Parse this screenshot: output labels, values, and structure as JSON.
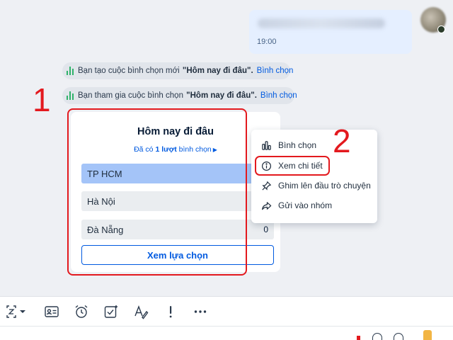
{
  "message": {
    "time": "19:00"
  },
  "notices": [
    {
      "prefix": "Bạn tạo cuộc bình chọn mới",
      "quote": "\"Hôm nay đi đâu\".",
      "link": "Bình chọn"
    },
    {
      "prefix": "Bạn tham gia cuộc bình chọn",
      "quote": "\"Hôm nay đi đâu\".",
      "link": "Bình chọn"
    }
  ],
  "annotations": {
    "step1": "1",
    "step2": "2",
    "color": "#e3191e"
  },
  "poll": {
    "title": "Hôm nay đi đâu",
    "votes_prefix": "Đã có",
    "votes_bold": "1 lượt",
    "votes_suffix": "bình chọn",
    "options": [
      {
        "label": "TP HCM",
        "count": "",
        "share": 1.0
      },
      {
        "label": "Hà Nội",
        "count": "",
        "share": 0
      },
      {
        "label": "Đà Nẵng",
        "count": "0",
        "share": 0
      }
    ],
    "view_button": "Xem lựa chọn"
  },
  "context_menu": {
    "items": [
      {
        "label": "Bình chọn",
        "icon": "poll-chart-icon"
      },
      {
        "label": "Xem chi tiết",
        "icon": "info-icon"
      },
      {
        "label": "Ghim lên đầu trò chuyện",
        "icon": "pin-icon"
      },
      {
        "label": "Gửi vào nhóm",
        "icon": "share-forward-icon"
      }
    ]
  },
  "toolbar": {
    "tools": [
      "screenshot-icon",
      "contact-card-icon",
      "alarm-clock-icon",
      "task-check-icon",
      "text-format-icon",
      "important-exclamation-icon",
      "more-dots-icon"
    ]
  },
  "colors": {
    "accent": "#005ae0",
    "poll_bar": "#a4c4f8",
    "notice_bg": "#e1e5eb",
    "outgoing_bubble": "#e5efff"
  }
}
